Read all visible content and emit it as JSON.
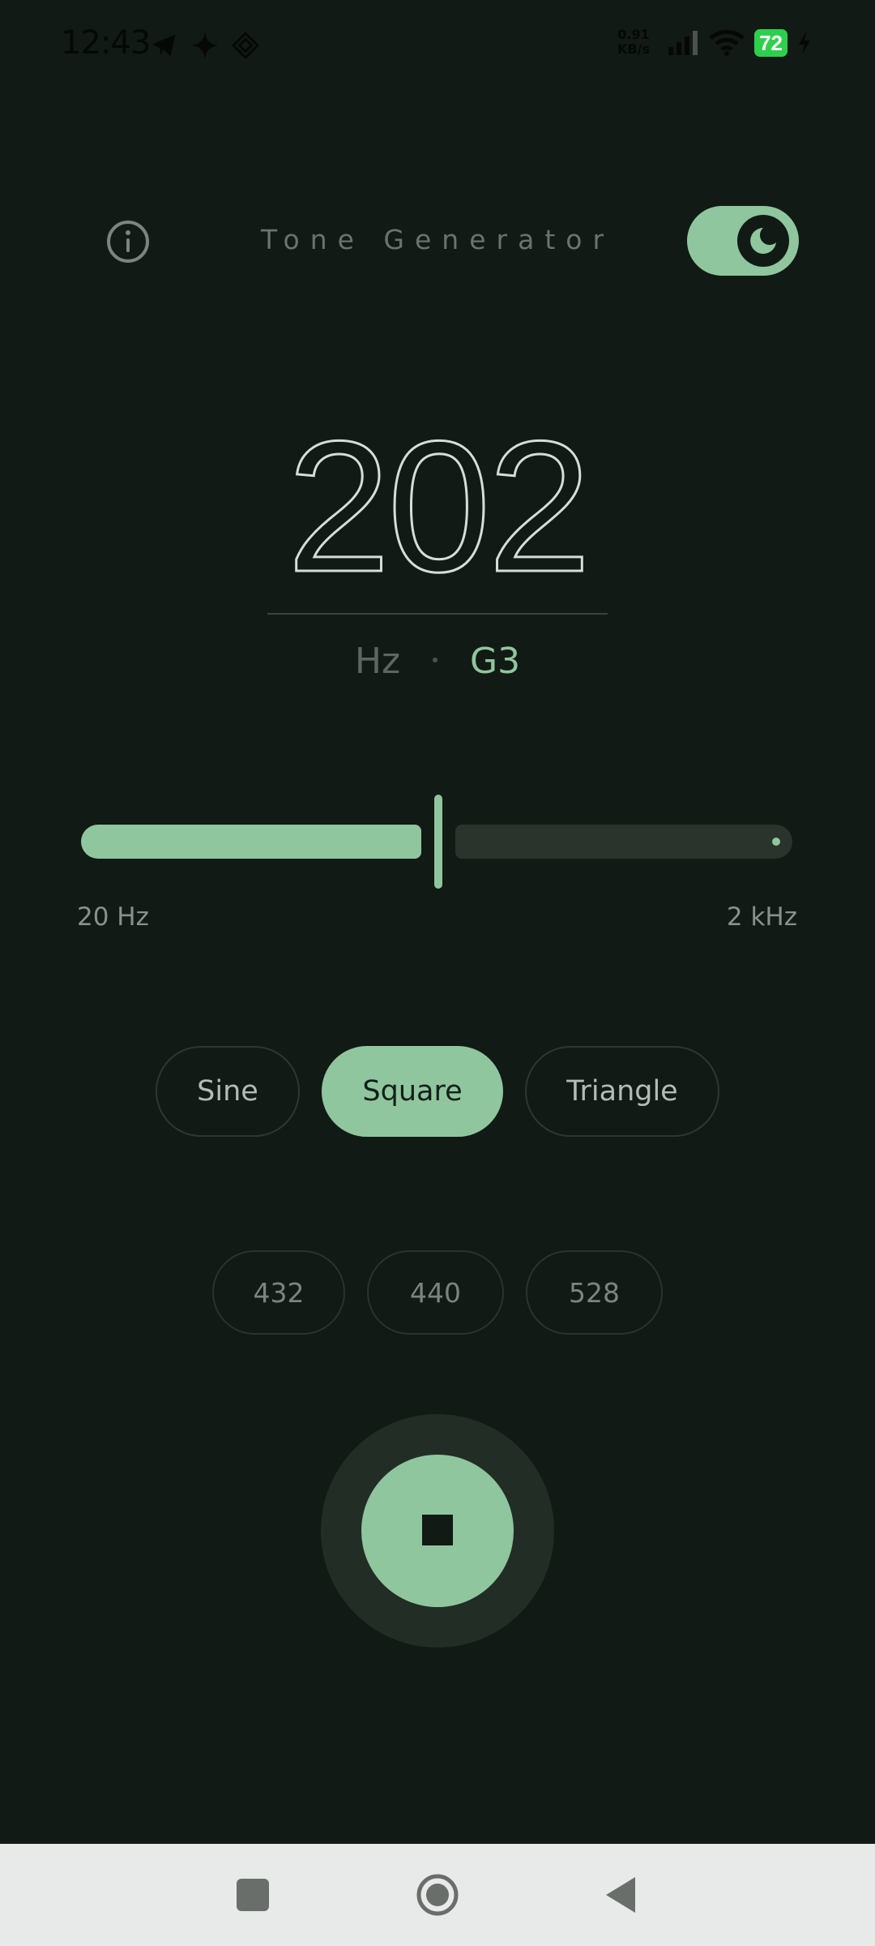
{
  "status_bar": {
    "time": "12:43",
    "net_speed_value": "0.91",
    "net_speed_unit": "KB/s",
    "battery": "72",
    "left_icons": [
      "telegram-icon",
      "sparkle-icon",
      "diamond-grid-icon"
    ],
    "right_icons": [
      "signal-icon",
      "wifi-icon",
      "battery-icon",
      "charging-bolt-icon"
    ]
  },
  "header": {
    "title": "Tone Generator",
    "info_icon": "info-icon",
    "theme_toggle_on": true,
    "theme_icon": "moon-icon"
  },
  "frequency": {
    "value": "202",
    "unit": "Hz",
    "note": "G3"
  },
  "slider": {
    "min_label": "20 Hz",
    "max_label": "2 kHz",
    "position_fraction": 0.5
  },
  "waveforms": {
    "options": [
      "Sine",
      "Square",
      "Triangle"
    ],
    "selected": "Square"
  },
  "presets": [
    "432",
    "440",
    "528"
  ],
  "playback": {
    "state": "playing",
    "button_icon": "stop-icon"
  },
  "nav_bar": {
    "buttons": [
      "recents-icon",
      "home-icon",
      "back-icon"
    ]
  },
  "colors": {
    "background": "#111a14",
    "accent": "#90c69e",
    "track": "#2a332c",
    "nav_bar": "#e8eae9"
  }
}
